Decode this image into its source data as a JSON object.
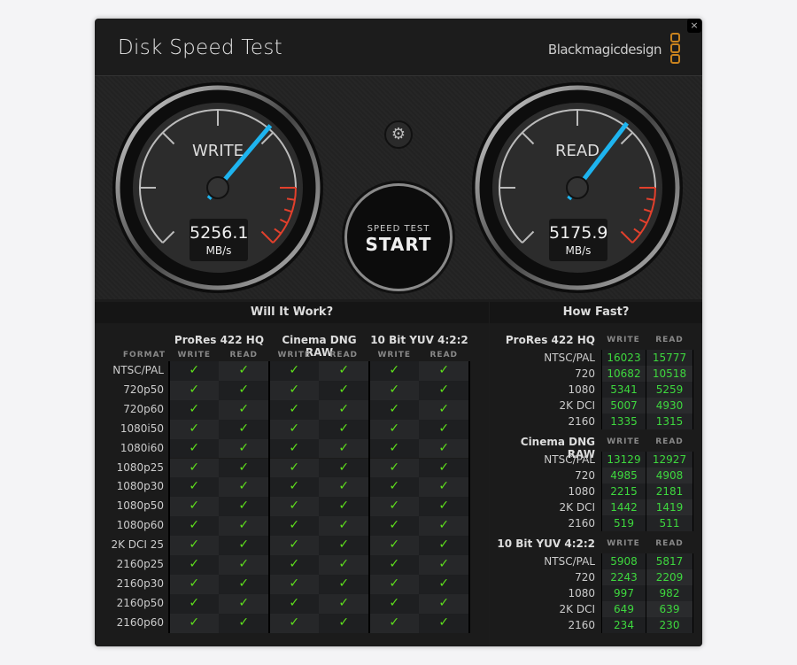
{
  "app": {
    "title": "Disk Speed Test",
    "brand": "Blackmagicdesign",
    "close_label": "×",
    "accent": "#c8821e"
  },
  "gauges": {
    "write": {
      "label": "WRITE",
      "value": "5256.1",
      "unit": "MB/s",
      "level_mbps": 5256.1
    },
    "read": {
      "label": "READ",
      "value": "5175.9",
      "unit": "MB/s",
      "level_mbps": 5175.9
    },
    "needle_color": "#1eb4ef",
    "redline_color": "#e2402c"
  },
  "start_button": {
    "line1": "SPEED TEST",
    "line2": "START"
  },
  "settings_icon": "gear-icon",
  "will_it_work": {
    "title": "Will It Work?",
    "format_header": "FORMAT",
    "groups": [
      "ProRes 422 HQ",
      "Cinema DNG RAW",
      "10 Bit YUV 4:2:2"
    ],
    "subheaders": [
      "WRITE",
      "READ"
    ],
    "rows": [
      "NTSC/PAL",
      "720p50",
      "720p60",
      "1080i50",
      "1080i60",
      "1080p25",
      "1080p30",
      "1080p50",
      "1080p60",
      "2K DCI 25",
      "2160p25",
      "2160p30",
      "2160p50",
      "2160p60"
    ],
    "check_glyph": "✓",
    "status": "all-supported"
  },
  "how_fast": {
    "title": "How Fast?",
    "subheaders": [
      "WRITE",
      "READ"
    ],
    "groups": [
      {
        "name": "ProRes 422 HQ",
        "rows": [
          [
            "NTSC/PAL",
            "16023",
            "15777"
          ],
          [
            "720",
            "10682",
            "10518"
          ],
          [
            "1080",
            "5341",
            "5259"
          ],
          [
            "2K DCI",
            "5007",
            "4930"
          ],
          [
            "2160",
            "1335",
            "1315"
          ]
        ]
      },
      {
        "name": "Cinema DNG RAW",
        "rows": [
          [
            "NTSC/PAL",
            "13129",
            "12927"
          ],
          [
            "720",
            "4985",
            "4908"
          ],
          [
            "1080",
            "2215",
            "2181"
          ],
          [
            "2K DCI",
            "1442",
            "1419"
          ],
          [
            "2160",
            "519",
            "511"
          ]
        ]
      },
      {
        "name": "10 Bit YUV 4:2:2",
        "rows": [
          [
            "NTSC/PAL",
            "5908",
            "5817"
          ],
          [
            "720",
            "2243",
            "2209"
          ],
          [
            "1080",
            "997",
            "982"
          ],
          [
            "2K DCI",
            "649",
            "639"
          ],
          [
            "2160",
            "234",
            "230"
          ]
        ]
      }
    ]
  }
}
